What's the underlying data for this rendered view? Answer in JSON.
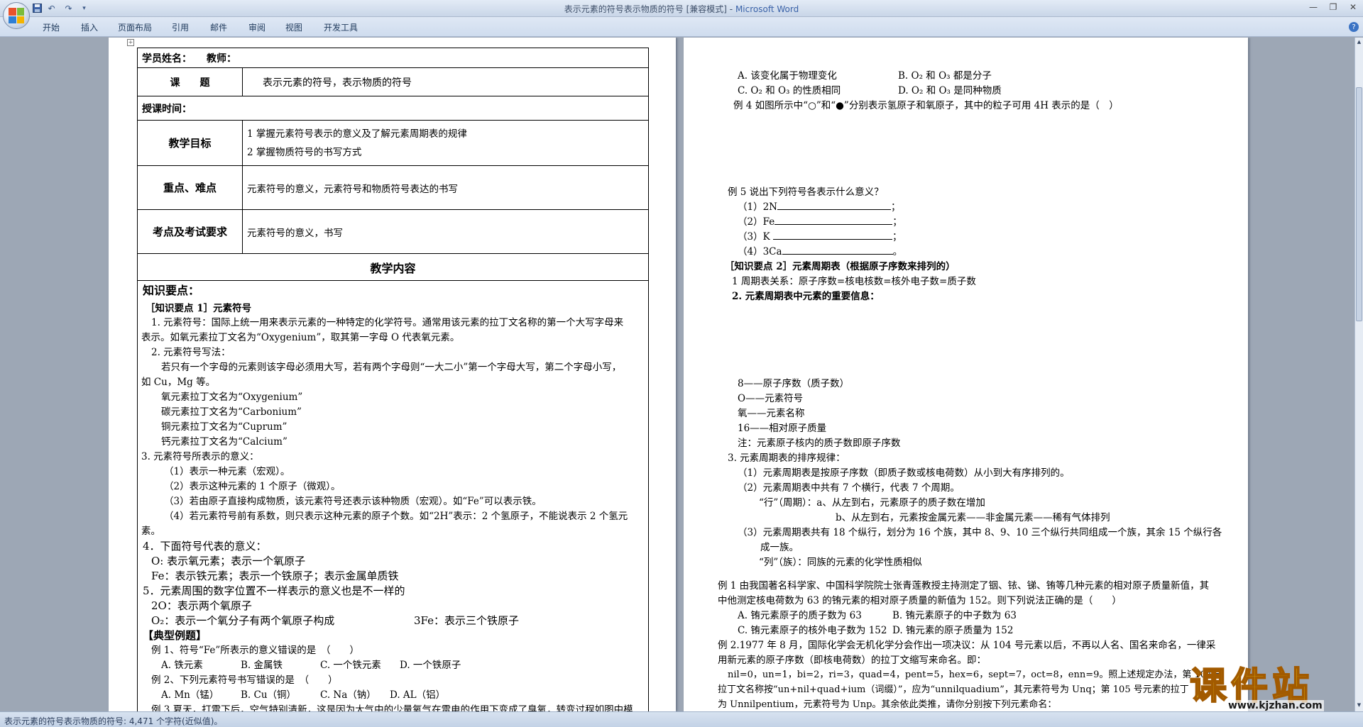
{
  "window": {
    "title": "表示元素的符号表示物质的符号 [兼容模式]",
    "app_name": "Microsoft Word",
    "separator": " - "
  },
  "quick_access": [
    "save-icon",
    "undo-icon",
    "redo-icon",
    "customize-icon"
  ],
  "menu_tabs": [
    "开始",
    "插入",
    "页面布局",
    "引用",
    "邮件",
    "审阅",
    "视图",
    "开发工具"
  ],
  "left_page": {
    "table": {
      "student_label": "学员姓名：",
      "teacher_label": "教师：",
      "topic_label": "课　　题",
      "topic_value": "表示元素的符号，表示物质的符号",
      "time_label": "授课时间：",
      "goals_label": "教学目标",
      "goal1": "1 掌握元素符号表示的意义及了解元素周期表的规律",
      "goal2": "2 掌握物质符号的书写方式",
      "focus_label": "重点、难点",
      "focus_value": "元素符号的意义，元素符号和物质符号表达的书写",
      "exam_label": "考点及考试要求",
      "exam_value": "元素符号的意义，书写",
      "content_title": "教学内容"
    },
    "lines": [
      "知识要点：",
      "［知识要点 1］元素符号",
      "1. 元素符号：国际上统一用来表示元素的一种特定的化学符号。通常用该元素的拉丁文名称的第一个大写字母来",
      "表示。如氧元素拉丁文名为“Oxygenium”，取其第一字母 O 代表氧元素。",
      "2. 元素符号写法：",
      "若只有一个字母的元素则该字母必须用大写，若有两个字母则“一大二小”第一个字母大写，第二个字母小写，",
      "如 Cu，Mg 等。",
      "氧元素拉丁文名为“Oxygenium”",
      "碳元素拉丁文名为“Carbonium”",
      "铜元素拉丁文名为“Cuprum”",
      "钙元素拉丁文名为“Calcium”",
      "3. 元素符号所表示的意义：",
      "（1）表示一种元素（宏观）。",
      "（2）表示这种元素的 1 个原子（微观）。",
      "（3）若由原子直接构成物质，该元素符号还表示该种物质（宏观）。如“Fe”可以表示铁。",
      "（4）若元素符号前有系数，则只表示这种元素的原子个数。如“2H”表示：2 个氢原子，不能说表示 2 个氢元",
      "素。",
      "4．下面符号代表的意义：",
      "O: 表示氧元素；表示一个氧原子",
      "Fe：表示铁元素；表示一个铁原子；表示金属单质铁",
      "5．元素周围的数字位置不一样表示的意义也是不一样的",
      "2O：表示两个氧原子",
      "O₂：表示一个氧分子有两个氧原子构成",
      "3Fe：表示三个铁原子",
      "【典型例题】",
      "例 1、符号“Fe”所表示的意义错误的是　（　　）",
      "A. 铁元素",
      "B. 金属铁",
      "C. 一个铁元素",
      "D. 一个铁原子",
      "例 2、下列元素符号书写错误的是　（　　）",
      "A. Mn（锰）",
      "B. Cu（铜）",
      "C. Na（钠）",
      "D. AL（铝）",
      "例 3 夏天，打雷下后，空气特别清新，这是因为大气中的少量氧气在雷电的作用下变成了臭氧，转变过程如图中模"
    ]
  },
  "right_page": {
    "lines": [
      "A. 该变化属于物理变化",
      "B. O₂ 和 O₃ 都是分子",
      "C. O₂ 和 O₃ 的性质相同",
      "D. O₂ 和 O₃ 是同种物质",
      "例 4 如图所示中“○”和“●”分别表示氢原子和氧原子，其中的粒子可用 4H 表示的是（　）",
      "例 5 说出下列符号各表示什么意义？",
      "（1）2N",
      "（2）Fe",
      "（3）K",
      "（4）3Ca",
      "［知识要点 2］元素周期表（根据原子序数来排列的）",
      "1 周期表关系：原子序数=核电核数=核外电子数=质子数",
      "2. 元素周期表中元素的重要信息：",
      "8——原子序数（质子数）",
      "O——元素符号",
      "氧——元素名称",
      "16——相对原子质量",
      "注：元素原子核内的质子数即原子序数",
      "3. 元素周期表的排序规律：",
      "（1）元素周期表是按原子序数（即质子数或核电荷数）从小到大有序排列的。",
      "（2）元素周期表中共有 7 个横行，代表 7 个周期。",
      "“行”（周期）：a、从左到右，元素原子的质子数在增加",
      "b、从左到右，元素按金属元素——非金属元素——稀有气体排列",
      "（3）元素周期表共有 18 个纵行，划分为 16 个族，其中 8、9、10 三个纵行共同组成一个族，其余 15 个纵行各",
      "成一族。",
      "“列”（族）：同族的元素的化学性质相似",
      "例 1 由我国著名科学家、中国科学院院士张青莲教授主持测定了铟、铱、锑、铕等几种元素的相对原子质量新值，其",
      "中他测定核电荷数为 63 的铕元素的相对原子质量的新值为 152。则下列说法正确的是（　　）",
      "A. 铕元素原子的质子数为 63",
      "B. 铕元素原子的中子数为 63",
      "C. 铕元素原子的核外电子数为 152",
      "D. 铕元素的原子质量为 152",
      "例 2.1977 年 8 月，国际化学会无机化学分会作出一项决议：从 104 号元素以后，不再以人名、国名来命名，一律采",
      "用新元素的原子序数（即核电荷数）的拉丁文缩写来命名。即：",
      "nil=0，un=1，bi=2，ri=3，quad=4，pent=5，hex=6，sept=7，oct=8，enn=9。照上述规定办法，第 104 号",
      "拉丁文名称按“un+nil+quad+ium（词缀）”，应为“unnilquadium”，其元素符号为 Unq；第 105 号元素的拉丁",
      "为 Unnilpentium，元素符号为 Unp。其余依此类推，请你分别按下列元素命名："
    ]
  },
  "status": {
    "text": "表示元素的符号表示物质的符号: 4,471 个字符(近似值)。"
  },
  "watermark": {
    "text": "课件站",
    "url": "www.kjzhan.com"
  }
}
